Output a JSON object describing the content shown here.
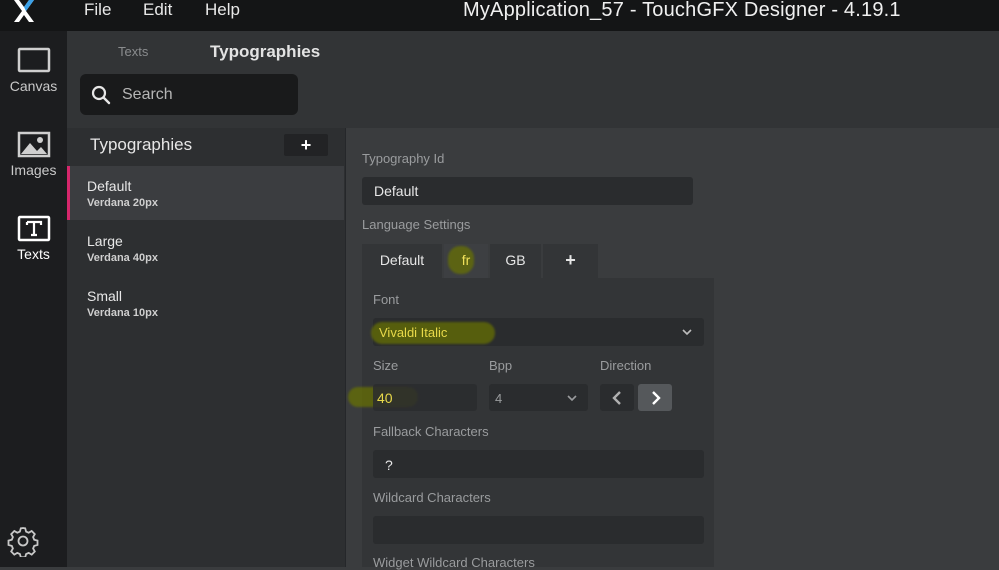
{
  "titlebar": {
    "menu": [
      "File",
      "Edit",
      "Help"
    ],
    "app_title": "MyApplication_57 - TouchGFX Designer - 4.19.1"
  },
  "leftbar": {
    "items": [
      {
        "label": "Canvas",
        "icon": "canvas-icon"
      },
      {
        "label": "Images",
        "icon": "images-icon"
      },
      {
        "label": "Texts",
        "icon": "texts-icon",
        "active": true
      }
    ],
    "settings_icon": "gear-icon"
  },
  "toppanel": {
    "tabs": [
      "Texts",
      "Typographies"
    ],
    "search_placeholder": "Search"
  },
  "typography_list": {
    "header": "Typographies",
    "add_label": "+",
    "items": [
      {
        "name": "Default",
        "font": "Verdana  20px",
        "selected": true
      },
      {
        "name": "Large",
        "font": "Verdana  40px"
      },
      {
        "name": "Small",
        "font": "Verdana  10px"
      }
    ]
  },
  "details": {
    "typography_id_label": "Typography Id",
    "typography_id_value": "Default",
    "language_settings_label": "Language Settings",
    "language_tabs": [
      "Default",
      "fr",
      "GB",
      "+"
    ],
    "active_language": "fr",
    "font_label": "Font",
    "font_value": "Vivaldi Italic",
    "size_label": "Size",
    "size_value": "40",
    "bpp_label": "Bpp",
    "bpp_value": "4",
    "direction_label": "Direction",
    "fallback_label": "Fallback Characters",
    "fallback_value": "?",
    "wildcard_label": "Wildcard Characters",
    "wildcard_value": "",
    "widget_wildcard_label": "Widget Wildcard Characters"
  },
  "colors": {
    "accent": "#d6276c",
    "highlight": "#6b7300",
    "highlight_text": "#e8d94a"
  }
}
